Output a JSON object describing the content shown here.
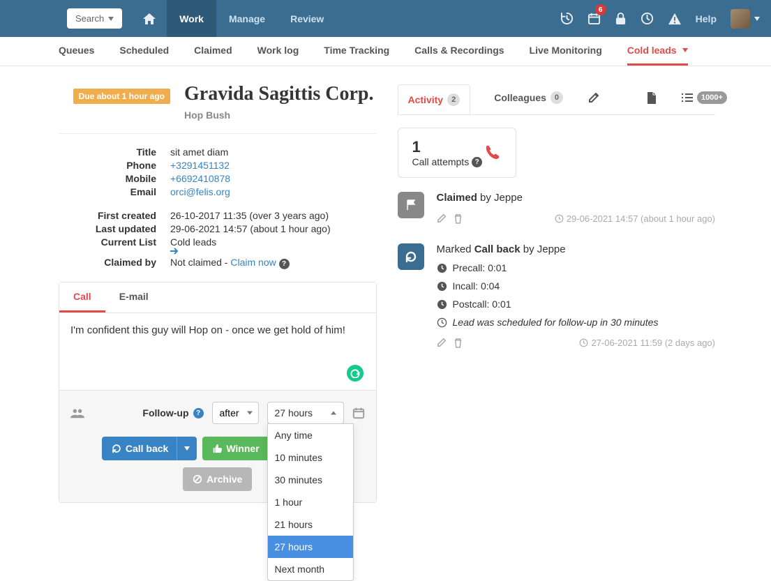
{
  "topnav": {
    "search_label": "Search",
    "links": {
      "work": "Work",
      "manage": "Manage",
      "review": "Review"
    },
    "icons": {
      "cal_badge": "6",
      "help": "Help"
    }
  },
  "subnav": {
    "queues": "Queues",
    "scheduled": "Scheduled",
    "claimed": "Claimed",
    "worklog": "Work log",
    "timetracking": "Time Tracking",
    "calls": "Calls & Recordings",
    "live": "Live Monitoring",
    "cold": "Cold leads"
  },
  "lead": {
    "due_badge": "Due about 1 hour ago",
    "title": "Gravida Sagittis Corp.",
    "subtitle": "Hop Bush",
    "labels": {
      "title": "Title",
      "phone": "Phone",
      "mobile": "Mobile",
      "email": "Email",
      "first_created": "First created",
      "last_updated": "Last updated",
      "current_list": "Current List",
      "claimed_by": "Claimed by"
    },
    "values": {
      "title": "sit amet diam",
      "phone": "+3291451132",
      "mobile": "+6692410878",
      "email": "orci@felis.org",
      "first_created": "26-10-2017 11:35 (over 3 years ago)",
      "last_updated": "29-06-2021 14:57 (about 1 hour ago)",
      "current_list": "Cold leads",
      "claimed_by_prefix": "Not claimed - ",
      "claim_now": "Claim now"
    }
  },
  "compose": {
    "tabs": {
      "call": "Call",
      "email": "E-mail"
    },
    "note": "I'm confident this guy will Hop on - once we get hold of him!",
    "followup_label": "Follow-up",
    "when_select": "after",
    "current_option": "27 hours",
    "options": [
      "Any time",
      "10 minutes",
      "30 minutes",
      "1 hour",
      "21 hours",
      "27 hours",
      "Next month"
    ],
    "buttons": {
      "callback": "Call back",
      "winner": "Winner",
      "archive": "Archive"
    }
  },
  "rpanel": {
    "tabs": {
      "activity": "Activity",
      "activity_count": "2",
      "colleagues": "Colleagues",
      "colleagues_count": "0",
      "list_count": "1000+"
    },
    "attempts": {
      "num": "1",
      "label": "Call attempts"
    }
  },
  "timeline": {
    "claimed": {
      "strong": "Claimed",
      "by": " by Jeppe",
      "stamp": "29-06-2021 14:57 (about 1 hour ago)"
    },
    "callback": {
      "prefix": "Marked ",
      "strong": "Call back",
      "by": " by Jeppe",
      "precall": "Precall: 0:01",
      "incall": "Incall: 0:04",
      "postcall": "Postcall: 0:01",
      "sched": "Lead was scheduled for follow-up in 30 minutes",
      "stamp": "27-06-2021 11:59 (2 days ago)"
    }
  }
}
